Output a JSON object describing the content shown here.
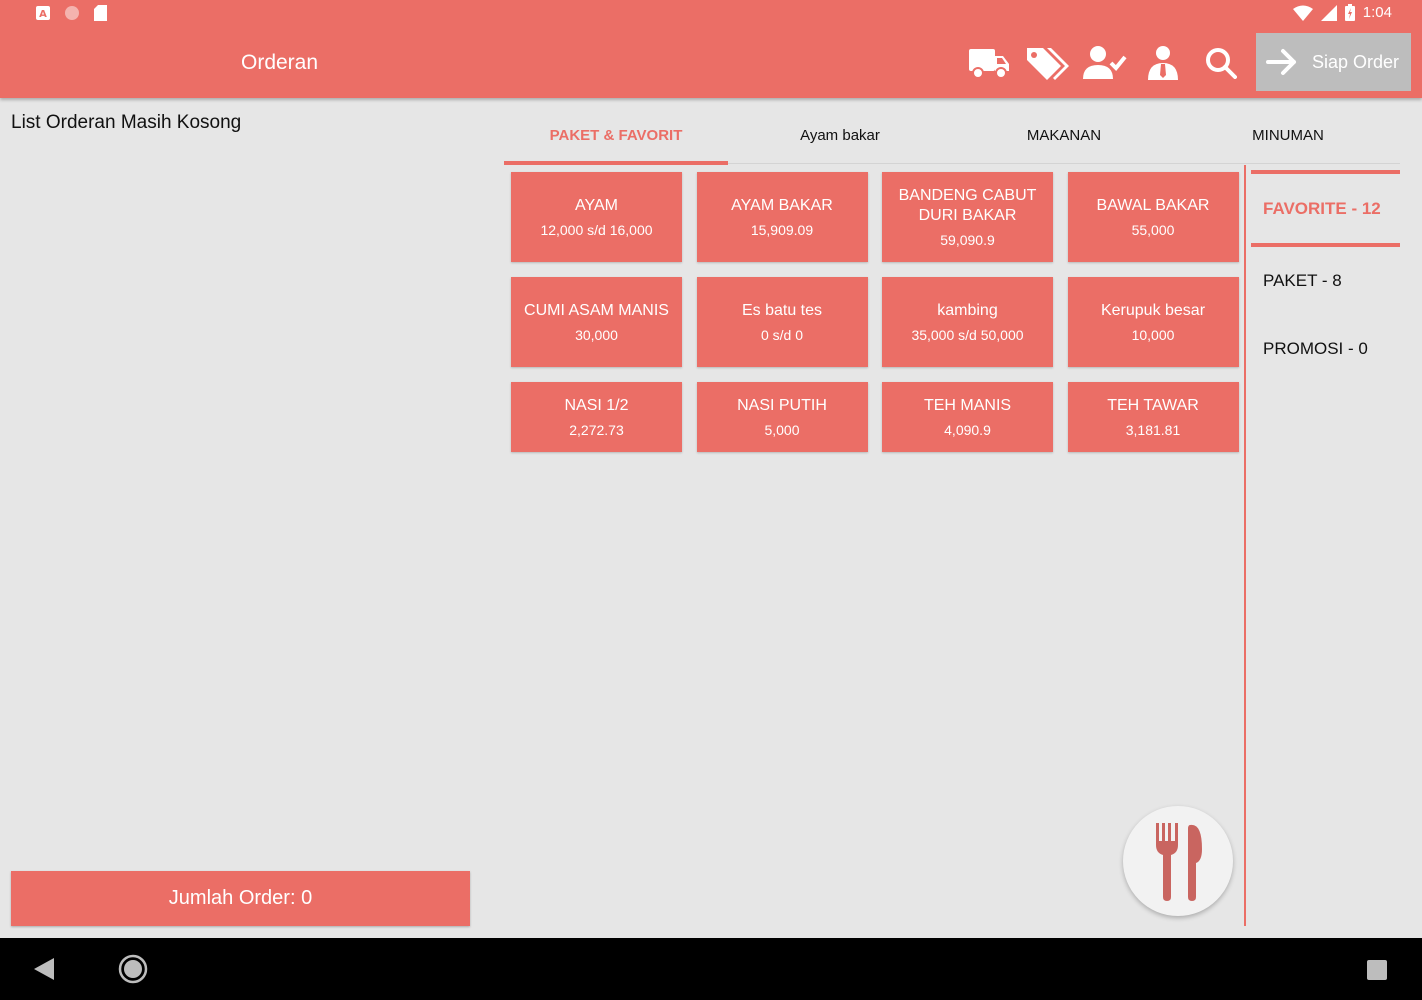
{
  "status_bar": {
    "time": "1:04",
    "left_icons": [
      "a-box-icon",
      "dot-icon",
      "sd-card-icon"
    ],
    "right_icons": [
      "wifi-icon",
      "signal-icon",
      "battery-icon"
    ]
  },
  "appbar": {
    "title": "Orderan",
    "actions": [
      "truck-icon",
      "tags-icon",
      "user-check-icon",
      "user-tie-icon",
      "search-icon"
    ],
    "ready_button": "Siap Order"
  },
  "order_panel": {
    "empty_text": "List Orderan Masih Kosong",
    "total_label": "Jumlah Order: 0"
  },
  "tabs": [
    {
      "label": "PAKET & FAVORIT",
      "active": true
    },
    {
      "label": "Ayam bakar",
      "active": false
    },
    {
      "label": "MAKANAN",
      "active": false
    },
    {
      "label": "MINUMAN",
      "active": false
    }
  ],
  "products": [
    {
      "name": "AYAM",
      "price": "12,000 s/d 16,000"
    },
    {
      "name": "AYAM BAKAR",
      "price": "15,909.09"
    },
    {
      "name": "BANDENG CABUT DURI BAKAR",
      "price": "59,090.9"
    },
    {
      "name": "BAWAL BAKAR",
      "price": "55,000"
    },
    {
      "name": "CUMI ASAM MANIS",
      "price": "30,000"
    },
    {
      "name": "Es batu tes",
      "price": "0 s/d 0"
    },
    {
      "name": "kambing",
      "price": "35,000 s/d 50,000"
    },
    {
      "name": "Kerupuk besar",
      "price": "10,000"
    },
    {
      "name": "NASI 1/2",
      "price": "2,272.73"
    },
    {
      "name": "NASI PUTIH",
      "price": "5,000"
    },
    {
      "name": "TEH MANIS",
      "price": "4,090.9"
    },
    {
      "name": "TEH TAWAR",
      "price": "3,181.81"
    }
  ],
  "categories": [
    {
      "label": "FAVORITE - 12",
      "active": true
    },
    {
      "label": "PAKET - 8",
      "active": false
    },
    {
      "label": "PROMOSI - 0",
      "active": false
    }
  ],
  "fab_icon": "utensils-icon",
  "colors": {
    "accent": "#eb6e66",
    "background": "#e6e6e6",
    "disabled": "#bdbdbd"
  }
}
